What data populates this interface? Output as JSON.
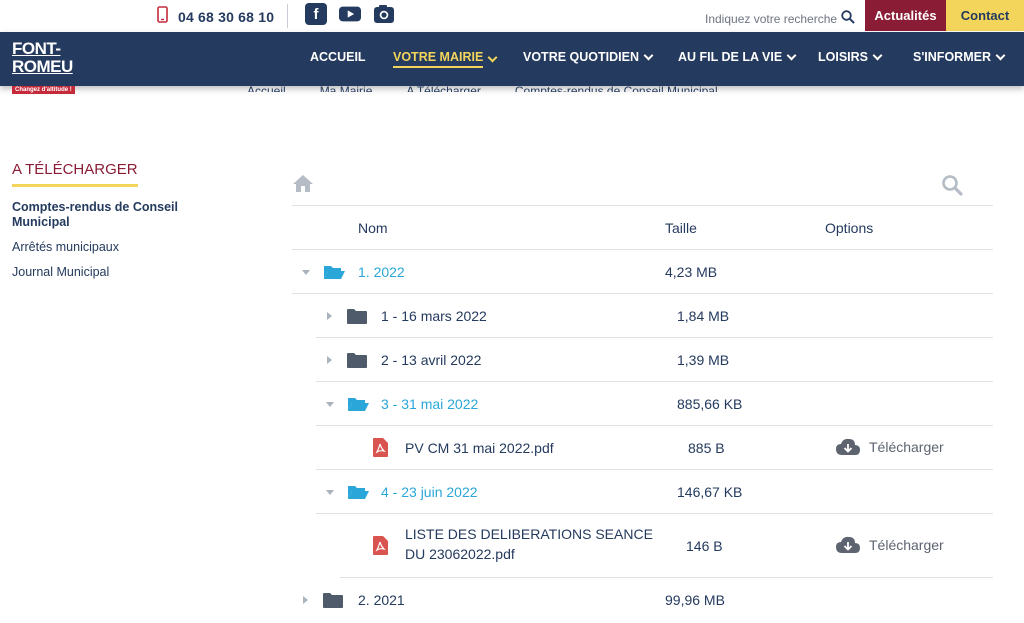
{
  "topbar": {
    "phone": "04 68 30 68 10",
    "search_placeholder": "Indiquez votre recherche",
    "btn_actualites": "Actualités",
    "btn_contact": "Contact",
    "social": [
      "facebook-icon",
      "youtube-icon",
      "instagram-icon"
    ]
  },
  "logo": {
    "main": "FONT-ROMEU",
    "sub": "Changez d'altitude !"
  },
  "nav": {
    "items": [
      {
        "label": "ACCUEIL",
        "dropdown": false,
        "active": false
      },
      {
        "label": "VOTRE MAIRIE",
        "dropdown": true,
        "active": true
      },
      {
        "label": "VOTRE QUOTIDIEN",
        "dropdown": true,
        "active": false
      },
      {
        "label": "AU FIL DE LA VIE",
        "dropdown": true,
        "active": false
      },
      {
        "label": "LOISIRS",
        "dropdown": true,
        "active": false
      },
      {
        "label": "S'INFORMER",
        "dropdown": true,
        "active": false
      }
    ]
  },
  "breadcrumb": [
    "Accueil",
    "Ma Mairie",
    "A Télécharger",
    "Comptes-rendus de Conseil Municipal"
  ],
  "sidebar": {
    "title": "A TÉLÉCHARGER",
    "links": [
      "Comptes-rendus de Conseil Municipal",
      "Arrêtés municipaux",
      "Journal Municipal"
    ]
  },
  "table": {
    "headers": {
      "name": "Nom",
      "size": "Taille",
      "options": "Options"
    },
    "download_label": "Télécharger",
    "rows": [
      {
        "name": "1. 2022",
        "size": "4,23 MB",
        "type": "folder",
        "open": true
      },
      {
        "name": "1 - 16 mars 2022",
        "size": "1,84 MB",
        "type": "folder",
        "open": false
      },
      {
        "name": "2 - 13 avril 2022",
        "size": "1,39 MB",
        "type": "folder",
        "open": false
      },
      {
        "name": "3 - 31 mai 2022",
        "size": "885,66 KB",
        "type": "folder",
        "open": true
      },
      {
        "name": "PV CM 31 mai 2022.pdf",
        "size": "885 B",
        "type": "pdf"
      },
      {
        "name": "4 - 23 juin 2022",
        "size": "146,67 KB",
        "type": "folder",
        "open": true
      },
      {
        "name": "LISTE DES DELIBERATIONS SEANCE DU 23062022.pdf",
        "size": "146 B",
        "type": "pdf"
      },
      {
        "name": "2. 2021",
        "size": "99,96 MB",
        "type": "folder",
        "open": false
      }
    ]
  },
  "colors": {
    "navy": "#243a5e",
    "burgundy": "#8a1d35",
    "yellow": "#f3d55b",
    "folder_open": "#2aa7d8",
    "pdf_red": "#d9534f"
  }
}
